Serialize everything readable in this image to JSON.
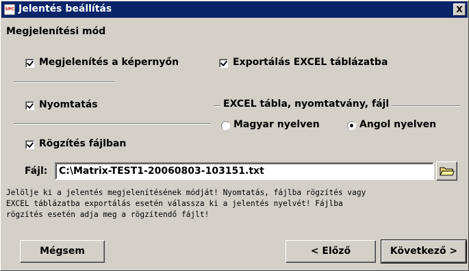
{
  "window": {
    "title": "Jelentés beállítás",
    "icon_text": "SPC",
    "close_label": "X"
  },
  "display_mode": {
    "heading": "Megjelenítési mód",
    "screen_checkbox": {
      "label": "Megjelenítés a képernyőn",
      "checked": true
    },
    "excel_checkbox": {
      "label": "Exportálás EXCEL táblázatba",
      "checked": true
    },
    "print_checkbox": {
      "label": "Nyomtatás",
      "checked": true
    },
    "file_checkbox": {
      "label": "Rögzítés fájlban",
      "checked": true
    }
  },
  "language_group": {
    "title": "EXCEL tábla, nyomtatvány, fájl",
    "options": [
      {
        "label": "Magyar nyelven",
        "selected": false
      },
      {
        "label": "Angol nyelven",
        "selected": true
      }
    ]
  },
  "file": {
    "label": "Fájl:",
    "value": "C:\\Matrix-TEST1-20060803-103151.txt"
  },
  "help_text": "Jelölje ki a jelentés megjelenítésének módját! Nyomtatás, fájlba rögzítés vagy\nEXCEL táblázatba exportálás esetén válassza ki a jelentés nyelvét! Fájlba\nrögzítés esetén adja meg a rögzítendő fájlt!",
  "buttons": {
    "cancel": "Mégsem",
    "prev": "< Előző",
    "next": "Következő >"
  }
}
